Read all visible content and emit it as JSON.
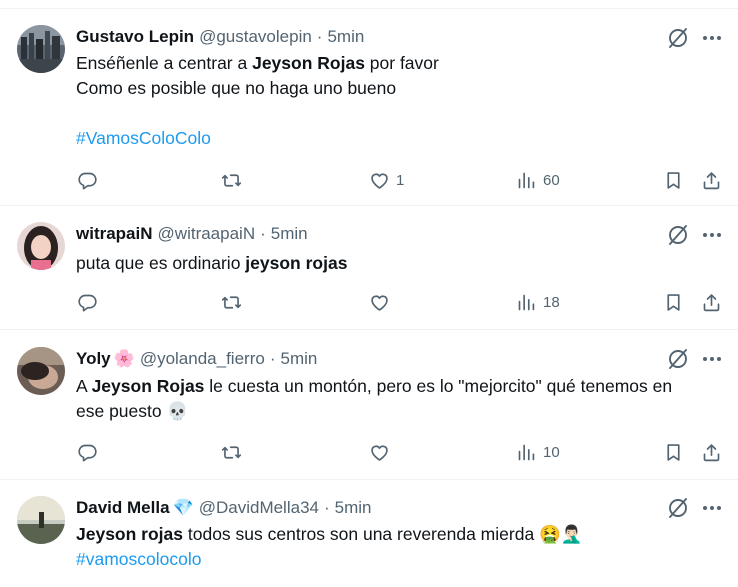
{
  "tweets": [
    {
      "name": "Gustavo Lepin",
      "name_emoji": "",
      "handle": "@gustavolepin",
      "separator": "·",
      "time": "5min",
      "lines": [
        [
          {
            "t": "Enséñenle a centrar a ",
            "b": false
          },
          {
            "t": "Jeyson Rojas",
            "b": true
          },
          {
            "t": " por favor",
            "b": false
          }
        ],
        [
          {
            "t": "Como es posible que no haga uno bueno",
            "b": false
          }
        ],
        [],
        [
          {
            "t": "#VamosColoColo",
            "h": true
          }
        ]
      ],
      "stats": {
        "reply": "",
        "retweet": "",
        "like": "1",
        "views": "60"
      }
    },
    {
      "name": "witrapaiN",
      "name_emoji": "",
      "handle": "@witraapaiN",
      "separator": "·",
      "time": "5min",
      "lines": [
        [
          {
            "t": "puta que es ordinario ",
            "b": false
          },
          {
            "t": "jeyson rojas",
            "b": true
          }
        ]
      ],
      "stats": {
        "reply": "",
        "retweet": "",
        "like": "",
        "views": "18"
      }
    },
    {
      "name": "Yoly",
      "name_emoji": "🌸",
      "handle": "@yolanda_fierro",
      "separator": "·",
      "time": "5min",
      "lines": [
        [
          {
            "t": "A ",
            "b": false
          },
          {
            "t": "Jeyson Rojas",
            "b": true
          },
          {
            "t": " le cuesta un montón, pero es lo \"mejorcito\" qué tenemos en",
            "b": false
          }
        ],
        [
          {
            "t": "ese puesto ",
            "b": false
          },
          {
            "t": "💀",
            "b": false
          }
        ]
      ],
      "stats": {
        "reply": "",
        "retweet": "",
        "like": "",
        "views": "10"
      }
    },
    {
      "name": "David Mella",
      "name_emoji": "💎",
      "handle": "@DavidMella34",
      "separator": "·",
      "time": "5min",
      "lines": [
        [
          {
            "t": "Jeyson rojas",
            "b": true
          },
          {
            "t": " todos sus centros son una reverenda mierda ",
            "b": false
          },
          {
            "t": "🤮🤦🏻‍♂️",
            "b": false
          }
        ],
        [
          {
            "t": "#vamoscolocolo",
            "h": true
          }
        ]
      ],
      "stats": {
        "reply": "",
        "retweet": "",
        "like": "",
        "views": ""
      }
    }
  ],
  "icons": {
    "grok": "grok-slash-icon",
    "more": "more-dots-icon",
    "reply": "reply-bubble-icon",
    "retweet": "retweet-arrows-icon",
    "like": "heart-icon",
    "views": "views-bars-icon",
    "bookmark": "bookmark-icon",
    "share": "share-upload-icon"
  },
  "colors": {
    "text": "#0f1419",
    "muted": "#536471",
    "link": "#1d9bf0",
    "divider": "#eff3f4"
  }
}
